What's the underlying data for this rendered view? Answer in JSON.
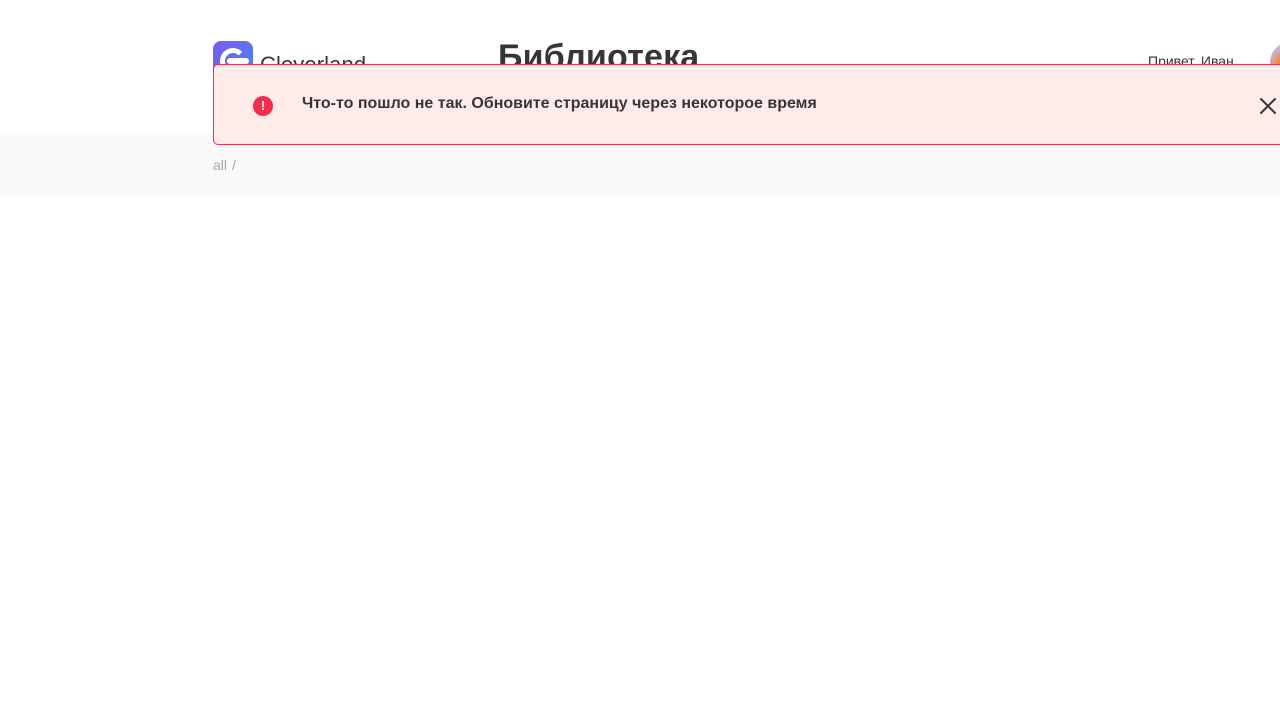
{
  "header": {
    "logo_text": "Cleverland",
    "title": "Библиотека",
    "greeting": "Привет, Иван"
  },
  "breadcrumb": {
    "items": [
      "all",
      "/"
    ]
  },
  "toast": {
    "icon": "alert-circle-icon",
    "message": "Что-то пошло не так. Обновите страницу через некоторое время",
    "close_icon": "close-icon"
  },
  "colors": {
    "error_accent": "#f42c4f",
    "error_background": "#feebea",
    "brand_gradient_start": "#7a5cf0",
    "brand_gradient_end": "#4f8cf3",
    "text": "#363636"
  }
}
